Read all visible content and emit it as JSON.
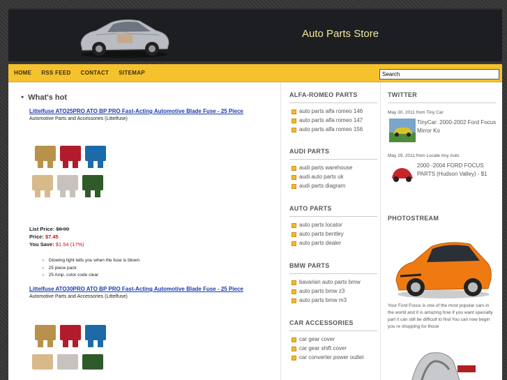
{
  "header": {
    "site_title": "Auto Parts Store"
  },
  "nav": {
    "items": [
      "HOME",
      "RSS FEED",
      "CONTACT",
      "SITEMAP"
    ],
    "search_value": "Search"
  },
  "main": {
    "heading": "What's hot",
    "products": [
      {
        "title": "Littelfuse ATO25PRO ATO BP PRO Fast-Acting Automotive Blade Fuse - 25 Piece",
        "category": "Automotive Parts and Accessories (Littelfuse)",
        "list_price_label": "List Price:",
        "list_price": "$8.99",
        "price_label": "Price:",
        "price": "$7.45",
        "save_label": "You Save:",
        "save": "$1.54 (17%)",
        "features": [
          "Glowing light tells you when the fuse is blown",
          "25 piece pack",
          "25 Amp. color code clear"
        ]
      },
      {
        "title": "Littelfuse ATO30PRO ATO BP PRO Fast-Acting Automotive Blade Fuse - 25 Piece",
        "category": "Automotive Parts and Accessories (Littelfuse)"
      }
    ]
  },
  "mid_sidebar": {
    "sections": [
      {
        "title": "ALFA-ROMEO PARTS",
        "items": [
          "auto parts alfa romeo 146",
          "auto parts alfa romeo 147",
          "auto parts alfa romeo 156"
        ]
      },
      {
        "title": "AUDI PARTS",
        "items": [
          "audi parts warehouse",
          "audi auto parts uk",
          "audi parts diagram"
        ]
      },
      {
        "title": "AUTO PARTS",
        "items": [
          "auto parts locator",
          "auto parts bentley",
          "auto parts dealer"
        ]
      },
      {
        "title": "BMW PARTS",
        "items": [
          "bavarian auto parts bmw",
          "auto parts bmw z3",
          "auto parts bmw m3"
        ]
      },
      {
        "title": "CAR ACCESSORIES",
        "items": [
          "car gear cover",
          "car gear shift cover",
          "car converter power outlet"
        ]
      }
    ]
  },
  "right_sidebar": {
    "twitter_title": "TWITTER",
    "tweets": [
      {
        "meta": "May 30, 2011 from Tiny Car",
        "text": "TinyCar: 2000-2002 Ford Focus Mirror Ko"
      },
      {
        "meta": "May 29, 2011 from Locate Any Auto",
        "text": "2000 -2004 FORD FOCUS PARTS (Hudson Valley) - $1"
      }
    ],
    "photostream_title": "PHOTOSTREAM",
    "photo_caption": "Your Ford Focus is one of the most popular cars in the world and it is amazing how if you want specialty part it can still be difficult to find You can now begin you re shopping for those"
  },
  "colors": {
    "nav_bg": "#f5c12c",
    "header_bg": "#1c1e22",
    "title_color": "#f4e79a",
    "link": "#1a3ca8",
    "price_red": "#c4141a"
  }
}
